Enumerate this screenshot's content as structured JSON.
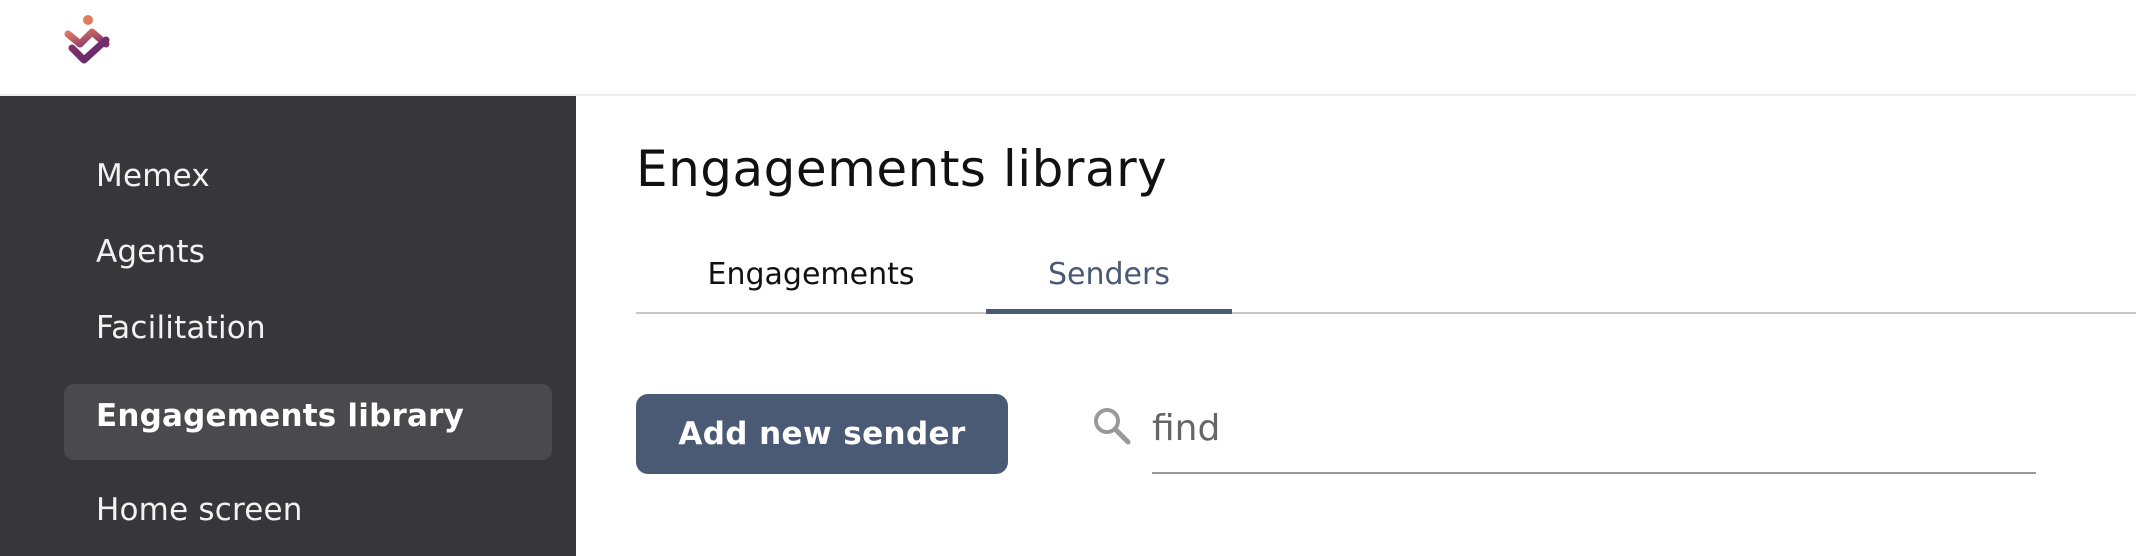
{
  "header": {
    "logo_icon": "brand-logo-icon"
  },
  "sidebar": {
    "items": [
      {
        "label": "Memex"
      },
      {
        "label": "Agents"
      },
      {
        "label": "Facilitation"
      },
      {
        "label": "Engagements library",
        "active": true
      },
      {
        "label": "Home screen"
      }
    ],
    "colors": {
      "background": "#37373b",
      "active_background": "#4a4a4e",
      "text": "#f2f2f2"
    }
  },
  "main": {
    "title": "Engagements library",
    "tabs": [
      {
        "label": "Engagements",
        "active": false
      },
      {
        "label": "Senders",
        "active": true
      }
    ],
    "add_button_label": "Add new sender",
    "search": {
      "icon": "search-icon",
      "value": "find",
      "placeholder": ""
    }
  },
  "colors": {
    "accent": "#4a5a75"
  }
}
